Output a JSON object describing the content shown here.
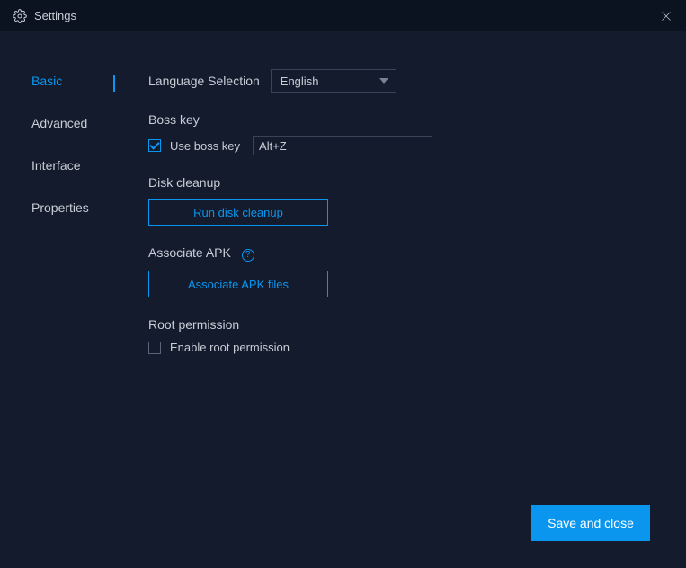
{
  "titlebar": {
    "title": "Settings"
  },
  "sidebar": {
    "items": [
      {
        "label": "Basic",
        "active": true
      },
      {
        "label": "Advanced",
        "active": false
      },
      {
        "label": "Interface",
        "active": false
      },
      {
        "label": "Properties",
        "active": false
      }
    ]
  },
  "main": {
    "language": {
      "label": "Language Selection",
      "value": "English"
    },
    "bosskey": {
      "title": "Boss key",
      "checkbox_label": "Use boss key",
      "checked": true,
      "input_value": "Alt+Z"
    },
    "diskcleanup": {
      "title": "Disk cleanup",
      "button": "Run disk cleanup"
    },
    "associate": {
      "title": "Associate APK",
      "button": "Associate APK files"
    },
    "root": {
      "title": "Root permission",
      "checkbox_label": "Enable root permission",
      "checked": false
    }
  },
  "footer": {
    "save": "Save and close"
  }
}
